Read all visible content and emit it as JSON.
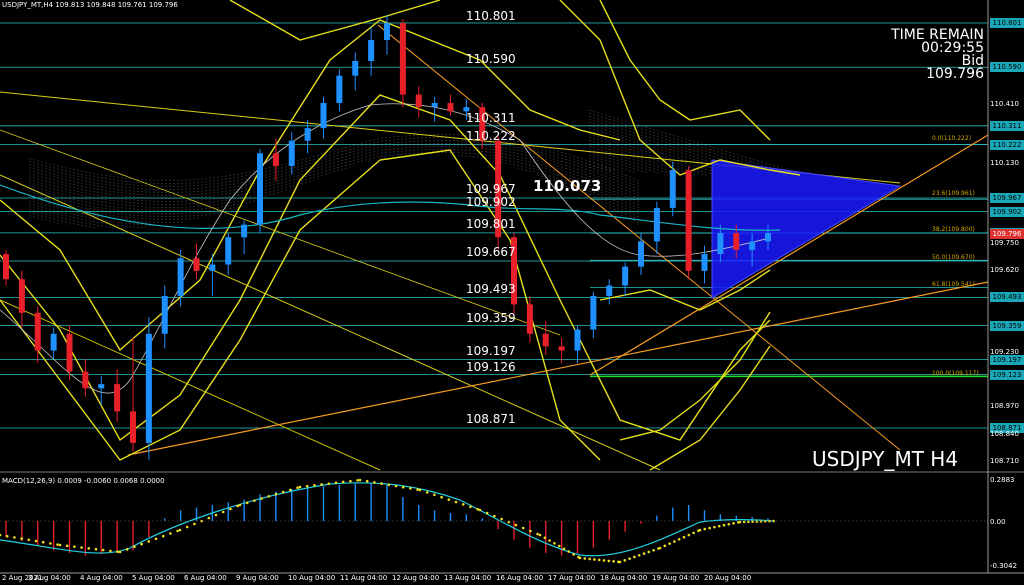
{
  "header": {
    "title": "USDJPY_MT,H4  109.813 109.848 109.761 109.796"
  },
  "timer": {
    "line1": "TIME REMAIN",
    "line2": "00:29:55",
    "line3": "Bid",
    "line4": "109.796"
  },
  "symbol_label": "USDJPY_MT H4",
  "highlight_price": "110.073",
  "levels": [
    {
      "label": "110.801"
    },
    {
      "label": "110.590"
    },
    {
      "label": "110.311"
    },
    {
      "label": "110.222"
    },
    {
      "label": "109.967"
    },
    {
      "label": "109.902"
    },
    {
      "label": "109.801"
    },
    {
      "label": "109.667"
    },
    {
      "label": "109.493"
    },
    {
      "label": "109.359"
    },
    {
      "label": "109.197"
    },
    {
      "label": "109.126"
    },
    {
      "label": "108.871"
    }
  ],
  "fib_labels": [
    "0.0(110.222)",
    "23.6(109.961)",
    "38.2(109.800)",
    "50.0(109.670)",
    "61.8(109.541)",
    "100.0(109.117)"
  ],
  "price_axis": {
    "ticks": [
      "110.801",
      "110.590",
      "110.410",
      "110.311",
      "110.222",
      "110.130",
      "109.967",
      "109.902",
      "109.801",
      "109.750",
      "109.620",
      "109.493",
      "109.359",
      "109.230",
      "109.197",
      "109.123",
      "108.970",
      "108.871",
      "108.840",
      "108.710"
    ],
    "bid_tag": "109.796"
  },
  "macd": {
    "label": "MACD(12,26,9) 0.0009 -0.0060 0.0068 0.0000",
    "axis_top": "0.2883",
    "axis_mid": "0.00",
    "axis_bottom": "-0.3042"
  },
  "time_axis": [
    "2 Aug 2021",
    "3 Aug 04:00",
    "4 Aug 04:00",
    "5 Aug 04:00",
    "6 Aug 04:00",
    "9 Aug 04:00",
    "10 Aug 04:00",
    "11 Aug 04:00",
    "12 Aug 04:00",
    "13 Aug 04:00",
    "16 Aug 04:00",
    "17 Aug 04:00",
    "18 Aug 04:00",
    "19 Aug 04:00",
    "20 Aug 04:00"
  ],
  "colors": {
    "bull": "#1e90ff",
    "bear": "#e8202a",
    "level_line": "#2ec4c4",
    "bollinger": "#e6e01a",
    "fib": "#d4aa00",
    "trend_orange": "#f59a23",
    "ma_cyan": "#18b6c4",
    "triangle": "#1a1aff"
  },
  "candles": [
    {
      "o": 109.7,
      "h": 109.72,
      "l": 109.55,
      "c": 109.58
    },
    {
      "o": 109.58,
      "h": 109.62,
      "l": 109.35,
      "c": 109.42
    },
    {
      "o": 109.42,
      "h": 109.45,
      "l": 109.18,
      "c": 109.24
    },
    {
      "o": 109.24,
      "h": 109.35,
      "l": 109.2,
      "c": 109.32
    },
    {
      "o": 109.32,
      "h": 109.36,
      "l": 109.1,
      "c": 109.14
    },
    {
      "o": 109.14,
      "h": 109.2,
      "l": 109.02,
      "c": 109.06
    },
    {
      "o": 109.06,
      "h": 109.12,
      "l": 108.98,
      "c": 109.08
    },
    {
      "o": 109.08,
      "h": 109.15,
      "l": 108.9,
      "c": 108.95
    },
    {
      "o": 108.95,
      "h": 109.3,
      "l": 108.76,
      "c": 108.8
    },
    {
      "o": 108.8,
      "h": 109.4,
      "l": 108.72,
      "c": 109.32
    },
    {
      "o": 109.32,
      "h": 109.55,
      "l": 109.25,
      "c": 109.5
    },
    {
      "o": 109.5,
      "h": 109.72,
      "l": 109.45,
      "c": 109.68
    },
    {
      "o": 109.68,
      "h": 109.75,
      "l": 109.58,
      "c": 109.62
    },
    {
      "o": 109.62,
      "h": 109.7,
      "l": 109.5,
      "c": 109.65
    },
    {
      "o": 109.65,
      "h": 109.8,
      "l": 109.6,
      "c": 109.78
    },
    {
      "o": 109.78,
      "h": 109.86,
      "l": 109.7,
      "c": 109.84
    },
    {
      "o": 109.84,
      "h": 110.2,
      "l": 109.8,
      "c": 110.18
    },
    {
      "o": 110.18,
      "h": 110.25,
      "l": 110.05,
      "c": 110.12
    },
    {
      "o": 110.12,
      "h": 110.28,
      "l": 110.08,
      "c": 110.24
    },
    {
      "o": 110.24,
      "h": 110.34,
      "l": 110.18,
      "c": 110.3
    },
    {
      "o": 110.3,
      "h": 110.45,
      "l": 110.25,
      "c": 110.42
    },
    {
      "o": 110.42,
      "h": 110.58,
      "l": 110.38,
      "c": 110.55
    },
    {
      "o": 110.55,
      "h": 110.66,
      "l": 110.48,
      "c": 110.62
    },
    {
      "o": 110.62,
      "h": 110.78,
      "l": 110.55,
      "c": 110.72
    },
    {
      "o": 110.72,
      "h": 110.84,
      "l": 110.65,
      "c": 110.8
    },
    {
      "o": 110.8,
      "h": 110.82,
      "l": 110.4,
      "c": 110.46
    },
    {
      "o": 110.46,
      "h": 110.5,
      "l": 110.35,
      "c": 110.4
    },
    {
      "o": 110.4,
      "h": 110.45,
      "l": 110.33,
      "c": 110.42
    },
    {
      "o": 110.42,
      "h": 110.46,
      "l": 110.36,
      "c": 110.38
    },
    {
      "o": 110.38,
      "h": 110.44,
      "l": 110.34,
      "c": 110.4
    },
    {
      "o": 110.4,
      "h": 110.42,
      "l": 110.2,
      "c": 110.24
    },
    {
      "o": 110.24,
      "h": 110.26,
      "l": 109.72,
      "c": 109.78
    },
    {
      "o": 109.78,
      "h": 109.8,
      "l": 109.4,
      "c": 109.46
    },
    {
      "o": 109.46,
      "h": 109.5,
      "l": 109.28,
      "c": 109.32
    },
    {
      "o": 109.32,
      "h": 109.38,
      "l": 109.22,
      "c": 109.26
    },
    {
      "o": 109.26,
      "h": 109.3,
      "l": 109.18,
      "c": 109.24
    },
    {
      "o": 109.24,
      "h": 109.36,
      "l": 109.18,
      "c": 109.34
    },
    {
      "o": 109.34,
      "h": 109.52,
      "l": 109.3,
      "c": 109.5
    },
    {
      "o": 109.5,
      "h": 109.58,
      "l": 109.46,
      "c": 109.55
    },
    {
      "o": 109.55,
      "h": 109.66,
      "l": 109.5,
      "c": 109.64
    },
    {
      "o": 109.64,
      "h": 109.8,
      "l": 109.6,
      "c": 109.76
    },
    {
      "o": 109.76,
      "h": 109.95,
      "l": 109.7,
      "c": 109.92
    },
    {
      "o": 109.92,
      "h": 110.14,
      "l": 109.88,
      "c": 110.1
    },
    {
      "o": 110.1,
      "h": 110.12,
      "l": 109.58,
      "c": 109.62
    },
    {
      "o": 109.62,
      "h": 109.74,
      "l": 109.56,
      "c": 109.7
    },
    {
      "o": 109.7,
      "h": 109.84,
      "l": 109.66,
      "c": 109.8
    },
    {
      "o": 109.8,
      "h": 109.84,
      "l": 109.68,
      "c": 109.72
    },
    {
      "o": 109.72,
      "h": 109.8,
      "l": 109.64,
      "c": 109.76
    },
    {
      "o": 109.76,
      "h": 109.84,
      "l": 109.72,
      "c": 109.8
    }
  ],
  "macd_hist": [
    -0.12,
    -0.15,
    -0.18,
    -0.22,
    -0.24,
    -0.26,
    -0.25,
    -0.24,
    -0.22,
    -0.12,
    0.02,
    0.08,
    0.1,
    0.12,
    0.14,
    0.16,
    0.2,
    0.22,
    0.24,
    0.25,
    0.26,
    0.27,
    0.28,
    0.28,
    0.27,
    0.18,
    0.12,
    0.08,
    0.06,
    0.05,
    0.02,
    -0.06,
    -0.14,
    -0.2,
    -0.24,
    -0.26,
    -0.24,
    -0.2,
    -0.14,
    -0.08,
    -0.02,
    0.04,
    0.1,
    0.12,
    0.08,
    0.05,
    0.04,
    0.03,
    0.02
  ]
}
